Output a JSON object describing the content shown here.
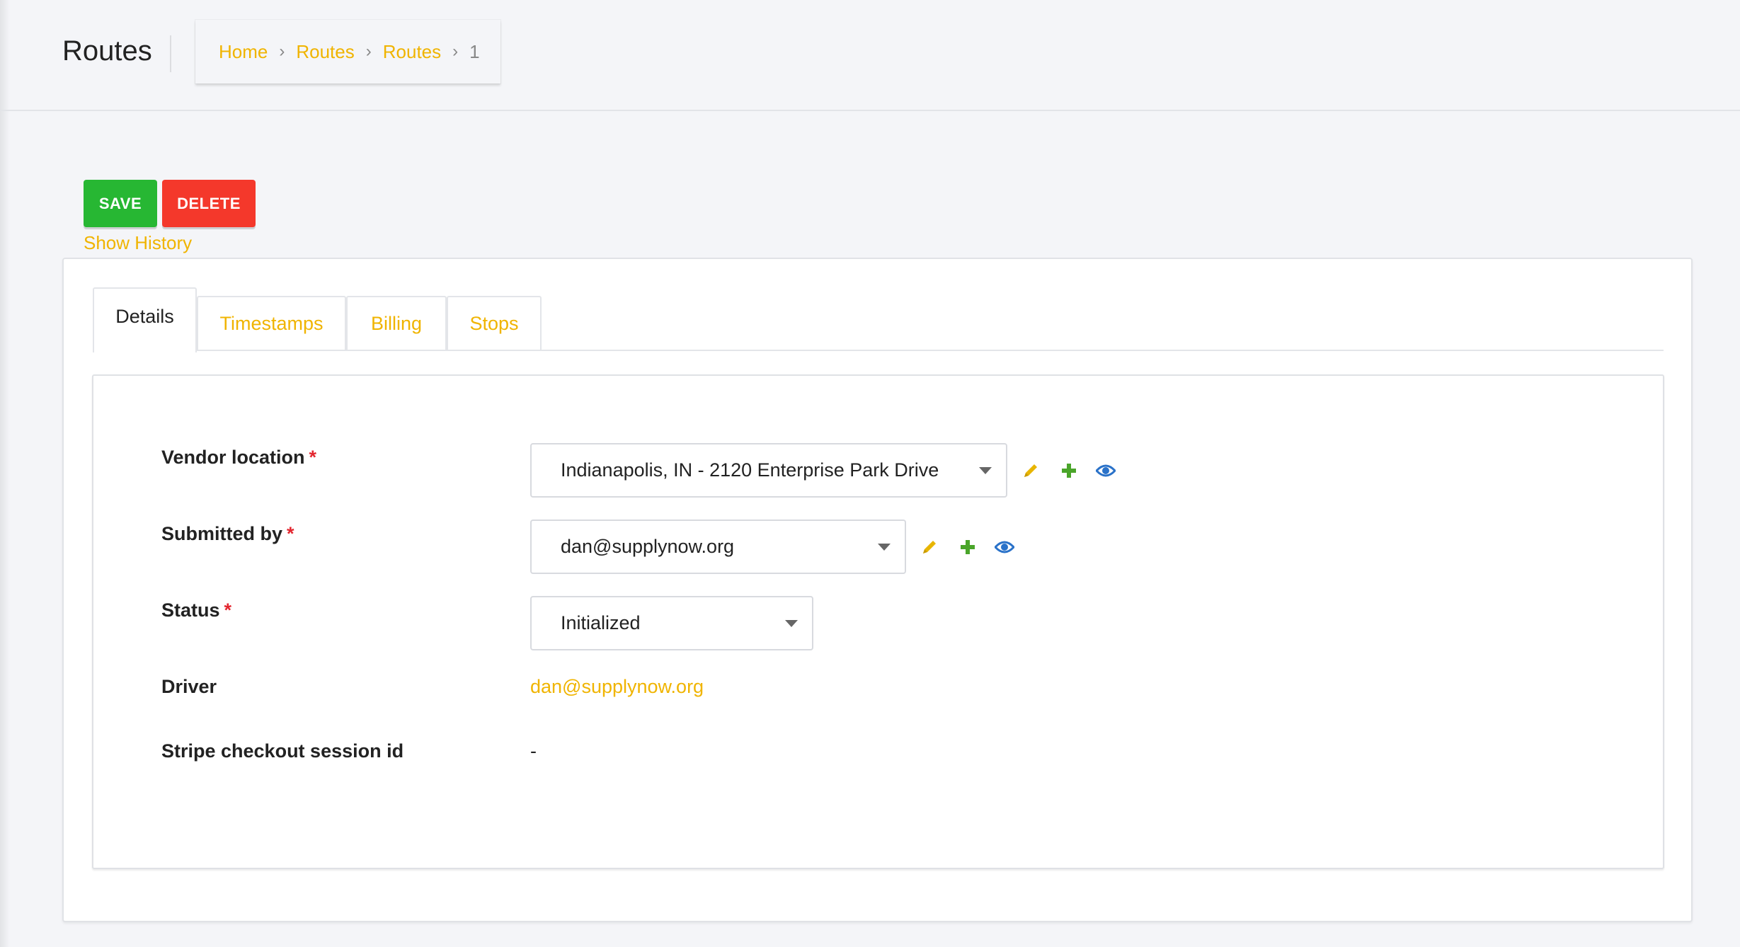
{
  "header": {
    "title": "Routes",
    "breadcrumb": [
      {
        "label": "Home",
        "link": true
      },
      {
        "label": "Routes",
        "link": true
      },
      {
        "label": "Routes",
        "link": true
      },
      {
        "label": "1",
        "link": false
      }
    ],
    "separator": "›"
  },
  "actions": {
    "save_label": "SAVE",
    "delete_label": "DELETE",
    "show_history_label": "Show History"
  },
  "tabs": [
    {
      "label": "Details",
      "active": true
    },
    {
      "label": "Timestamps",
      "active": false
    },
    {
      "label": "Billing",
      "active": false
    },
    {
      "label": "Stops",
      "active": false
    }
  ],
  "form": {
    "vendor_location": {
      "label": "Vendor location",
      "required_mark": "*",
      "value": "Indianapolis, IN - 2120 Enterprise Park Drive",
      "icons": [
        "pencil-icon",
        "plus-icon",
        "eye-icon"
      ]
    },
    "submitted_by": {
      "label": "Submitted by",
      "required_mark": "*",
      "value": "dan@supplynow.org",
      "icons": [
        "pencil-icon",
        "plus-icon",
        "eye-icon"
      ]
    },
    "status": {
      "label": "Status",
      "required_mark": "*",
      "value": "Initialized"
    },
    "driver": {
      "label": "Driver",
      "value": "dan@supplynow.org"
    },
    "stripe_checkout_session_id": {
      "label": "Stripe checkout session id",
      "value": "-"
    }
  },
  "colors": {
    "accent": "#f0b400",
    "save": "#27b733",
    "delete": "#f4382b",
    "required": "#e3262f",
    "plus_icon": "#4aa52a",
    "eye_icon": "#2a72c9",
    "pencil_icon": "#e8b500"
  }
}
